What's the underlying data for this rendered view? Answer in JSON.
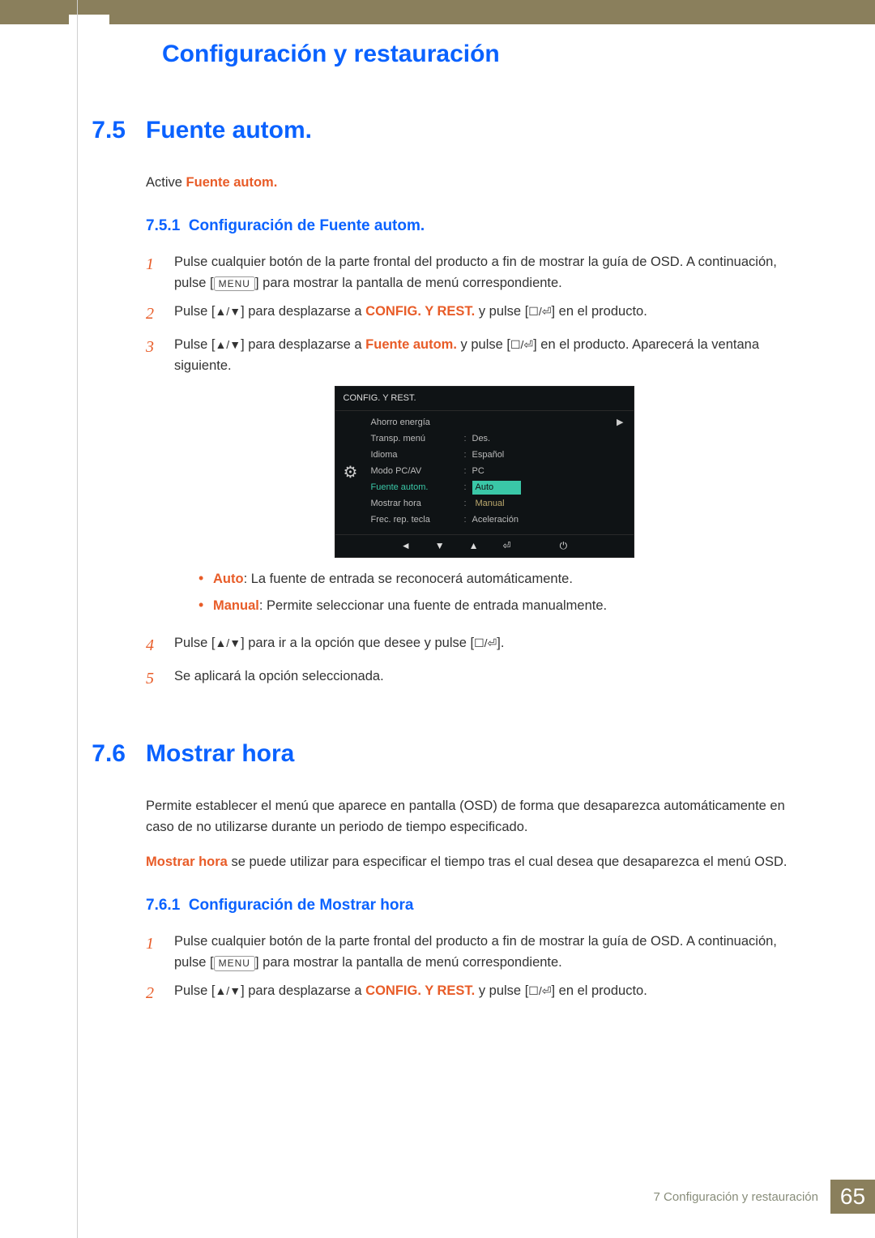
{
  "chapter_title": "Configuración y restauración",
  "s75": {
    "num": "7.5",
    "title": "Fuente autom.",
    "intro_a": "Active ",
    "intro_b": "Fuente autom.",
    "sub_num": "7.5.1",
    "sub_title": "Configuración de Fuente autom.",
    "step1a": "Pulse cualquier botón de la parte frontal del producto a fin de mostrar la guía de OSD. A continuación, pulse [",
    "step1_key": "MENU",
    "step1b": "] para mostrar la pantalla de menú correspondiente.",
    "step2a": "Pulse [",
    "step2b": "] para desplazarse a ",
    "step2_target": "CONFIG. Y REST.",
    "step2c": " y pulse [",
    "step2d": "] en el producto.",
    "step3a": "Pulse [",
    "step3b": "] para desplazarse a ",
    "step3_target": "Fuente autom.",
    "step3c": " y pulse [",
    "step3d": "] en el producto. Aparecerá la ventana siguiente.",
    "bullet1_k": "Auto",
    "bullet1_v": ": La fuente de entrada se reconocerá automáticamente.",
    "bullet2_k": "Manual",
    "bullet2_v": ": Permite seleccionar una fuente de entrada manualmente.",
    "step4a": "Pulse [",
    "step4b": "] para ir a la opción que desee y pulse [",
    "step4c": "].",
    "step5": "Se aplicará la opción seleccionada."
  },
  "osd": {
    "title": "CONFIG. Y REST.",
    "r1": "Ahorro energía",
    "r2": "Transp. menú",
    "r2v": "Des.",
    "r3": "Idioma",
    "r3v": "Español",
    "r4": "Modo PC/AV",
    "r4v": "PC",
    "r5": "Fuente autom.",
    "r5v_sel": "Auto",
    "r5v_opt": "Manual",
    "r6": "Mostrar hora",
    "r7": "Frec. rep. tecla",
    "r7v": "Aceleración"
  },
  "s76": {
    "num": "7.6",
    "title": "Mostrar hora",
    "p1": "Permite establecer el menú que aparece en pantalla (OSD) de forma que desaparezca automáticamente en caso de no utilizarse durante un periodo de tiempo especificado.",
    "p2_k": "Mostrar hora",
    "p2": " se puede utilizar para especificar el tiempo tras el cual desea que desaparezca el menú OSD.",
    "sub_num": "7.6.1",
    "sub_title": "Configuración de Mostrar hora",
    "step1a": "Pulse cualquier botón de la parte frontal del producto a fin de mostrar la guía de OSD. A continuación, pulse [",
    "step1_key": "MENU",
    "step1b": "] para mostrar la pantalla de menú correspondiente.",
    "step2a": "Pulse [",
    "step2b": "] para desplazarse a ",
    "step2_target": "CONFIG. Y REST.",
    "step2c": " y pulse [",
    "step2d": "] en el producto."
  },
  "footer": {
    "text": "7 Configuración y restauración",
    "page": "65"
  },
  "glyphs": {
    "updown": "▲/▼",
    "enter": "☐/⏎"
  }
}
